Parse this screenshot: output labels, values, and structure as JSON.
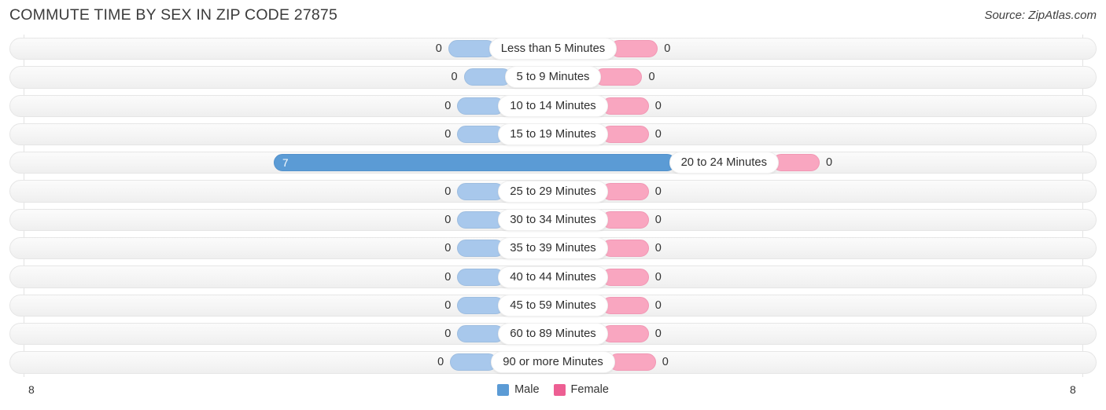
{
  "header": {
    "title": "COMMUTE TIME BY SEX IN ZIP CODE 27875",
    "source": "Source: ZipAtlas.com"
  },
  "axis": {
    "min_label": "8",
    "max_label": "8"
  },
  "legend": {
    "items": [
      {
        "label": "Male",
        "color": "#5b9bd5",
        "icon": "square-swatch-icon"
      },
      {
        "label": "Female",
        "color": "#ed5f93",
        "icon": "square-swatch-icon"
      }
    ]
  },
  "colors": {
    "male_light": "#a8c8ec",
    "male_strong": "#5b9bd5",
    "female_light": "#f9a6c0",
    "female_strong": "#ed5f93",
    "track": "#f5f5f5",
    "gridline": "#e3e3e3"
  },
  "chart_data": {
    "type": "bar",
    "orientation": "horizontal-diverging",
    "title": "COMMUTE TIME BY SEX IN ZIP CODE 27875",
    "subtitle": "",
    "xlabel": "",
    "ylabel": "",
    "xlim": [
      8,
      8
    ],
    "axis_tick_labels": [
      "8",
      "8"
    ],
    "grid": true,
    "legend_position": "bottom-center",
    "categories": [
      "Less than 5 Minutes",
      "5 to 9 Minutes",
      "10 to 14 Minutes",
      "15 to 19 Minutes",
      "20 to 24 Minutes",
      "25 to 29 Minutes",
      "30 to 34 Minutes",
      "35 to 39 Minutes",
      "40 to 44 Minutes",
      "45 to 59 Minutes",
      "60 to 89 Minutes",
      "90 or more Minutes"
    ],
    "series": [
      {
        "name": "Male",
        "values": [
          0,
          0,
          0,
          0,
          7,
          0,
          0,
          0,
          0,
          0,
          0,
          0
        ]
      },
      {
        "name": "Female",
        "values": [
          0,
          0,
          0,
          0,
          0,
          0,
          0,
          0,
          0,
          0,
          0,
          0
        ]
      }
    ]
  },
  "rows": [
    {
      "label": "Less than 5 Minutes",
      "male": "0",
      "female": "0",
      "male_pct": 0,
      "female_pct": 0
    },
    {
      "label": "5 to 9 Minutes",
      "male": "0",
      "female": "0",
      "male_pct": 0,
      "female_pct": 0
    },
    {
      "label": "10 to 14 Minutes",
      "male": "0",
      "female": "0",
      "male_pct": 0,
      "female_pct": 0
    },
    {
      "label": "15 to 19 Minutes",
      "male": "0",
      "female": "0",
      "male_pct": 0,
      "female_pct": 0
    },
    {
      "label": "20 to 24 Minutes",
      "male": "7",
      "female": "0",
      "male_pct": 87.5,
      "female_pct": 0
    },
    {
      "label": "25 to 29 Minutes",
      "male": "0",
      "female": "0",
      "male_pct": 0,
      "female_pct": 0
    },
    {
      "label": "30 to 34 Minutes",
      "male": "0",
      "female": "0",
      "male_pct": 0,
      "female_pct": 0
    },
    {
      "label": "35 to 39 Minutes",
      "male": "0",
      "female": "0",
      "male_pct": 0,
      "female_pct": 0
    },
    {
      "label": "40 to 44 Minutes",
      "male": "0",
      "female": "0",
      "male_pct": 0,
      "female_pct": 0
    },
    {
      "label": "45 to 59 Minutes",
      "male": "0",
      "female": "0",
      "male_pct": 0,
      "female_pct": 0
    },
    {
      "label": "60 to 89 Minutes",
      "male": "0",
      "female": "0",
      "male_pct": 0,
      "female_pct": 0
    },
    {
      "label": "90 or more Minutes",
      "male": "0",
      "female": "0",
      "male_pct": 0,
      "female_pct": 0
    }
  ]
}
